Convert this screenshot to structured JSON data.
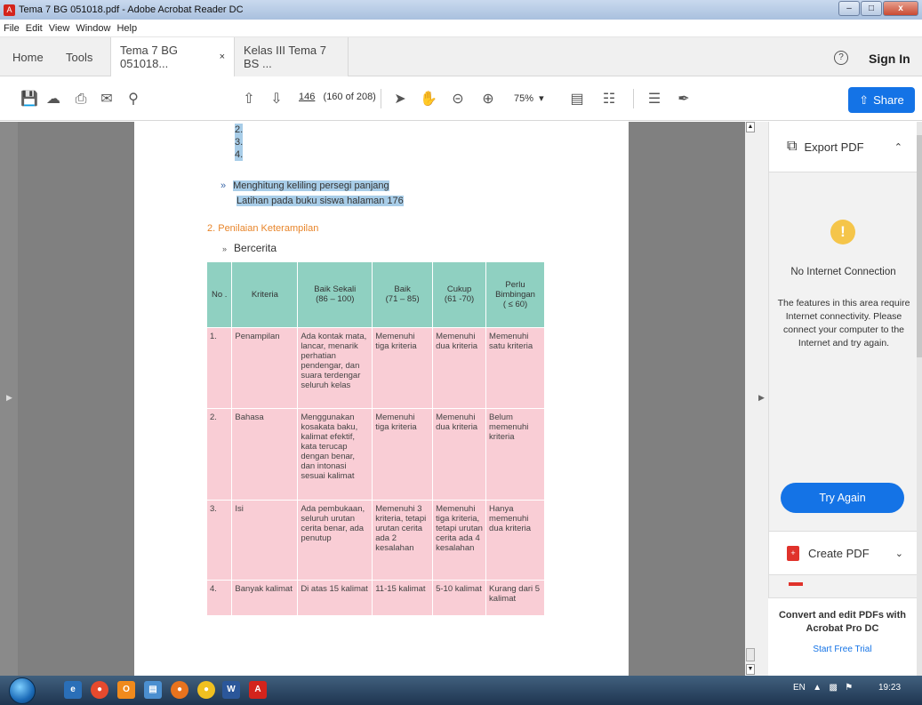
{
  "window": {
    "title": "Tema 7 BG 051018.pdf - Adobe Acrobat Reader DC"
  },
  "menu": [
    "File",
    "Edit",
    "View",
    "Window",
    "Help"
  ],
  "tabs": {
    "home": "Home",
    "tools": "Tools",
    "doc1": "Tema 7 BG 051018...",
    "doc2": "Kelas III Tema 7 BS ..."
  },
  "header": {
    "help": "?",
    "sign_in": "Sign In"
  },
  "toolbar": {
    "page_current": "146",
    "page_info": "(160 of 208)",
    "zoom": "75%",
    "share": "Share"
  },
  "doc": {
    "numbers": [
      "2.",
      "3.",
      "4."
    ],
    "bullet_line1": "Menghitung keliling persegi panjang",
    "bullet_line2": "Latihan pada buku siswa halaman 176",
    "section": "2.  Penilaian Keterampilan",
    "sub": "Bercerita",
    "table": {
      "headers": [
        "No .",
        "Kriteria",
        "Baik Sekali\n(86 – 100)",
        "Baik\n(71 – 85)",
        "Cukup\n(61 -70)",
        "Perlu\nBimbingan\n( ≤ 60)"
      ],
      "rows": [
        [
          "1.",
          "Penampilan",
          "Ada kontak mata, lancar, menarik perhatian pendengar, dan suara terdengar seluruh kelas",
          "Memenuhi tiga kriteria",
          "Memenuhi dua kriteria",
          "Memenuhi satu kriteria"
        ],
        [
          "2.",
          "Bahasa",
          "Menggunakan kosakata baku, kalimat efektif, kata terucap dengan benar, dan intonasi sesuai kalimat",
          "Memenuhi tiga kriteria",
          "Memenuhi dua kriteria",
          "Belum memenuhi kriteria"
        ],
        [
          "3.",
          "Isi",
          "Ada pembukaan, seluruh urutan cerita benar, ada penutup",
          "Memenuhi 3 kriteria, tetapi urutan cerita ada 2 kesalahan",
          "Memenuhi tiga kriteria, tetapi urutan cerita ada 4 kesalahan",
          "Hanya memenuhi dua kriteria"
        ],
        [
          "4.",
          "Banyak kalimat",
          "Di atas 15 kalimat",
          "11-15 kalimat",
          "5-10 kalimat",
          "Kurang dari 5 kalimat"
        ]
      ]
    }
  },
  "rpanel": {
    "export": "Export PDF",
    "warn": "!",
    "no_internet": "No Internet Connection",
    "features": "The features in this area require Internet connectivity. Please connect your computer to the Internet and try again.",
    "try_again": "Try Again",
    "create": "Create PDF",
    "promo_title": "Convert and edit PDFs with Acrobat Pro DC",
    "promo_link": "Start Free Trial"
  },
  "taskbar": {
    "lang": "EN",
    "time": "19:23"
  }
}
